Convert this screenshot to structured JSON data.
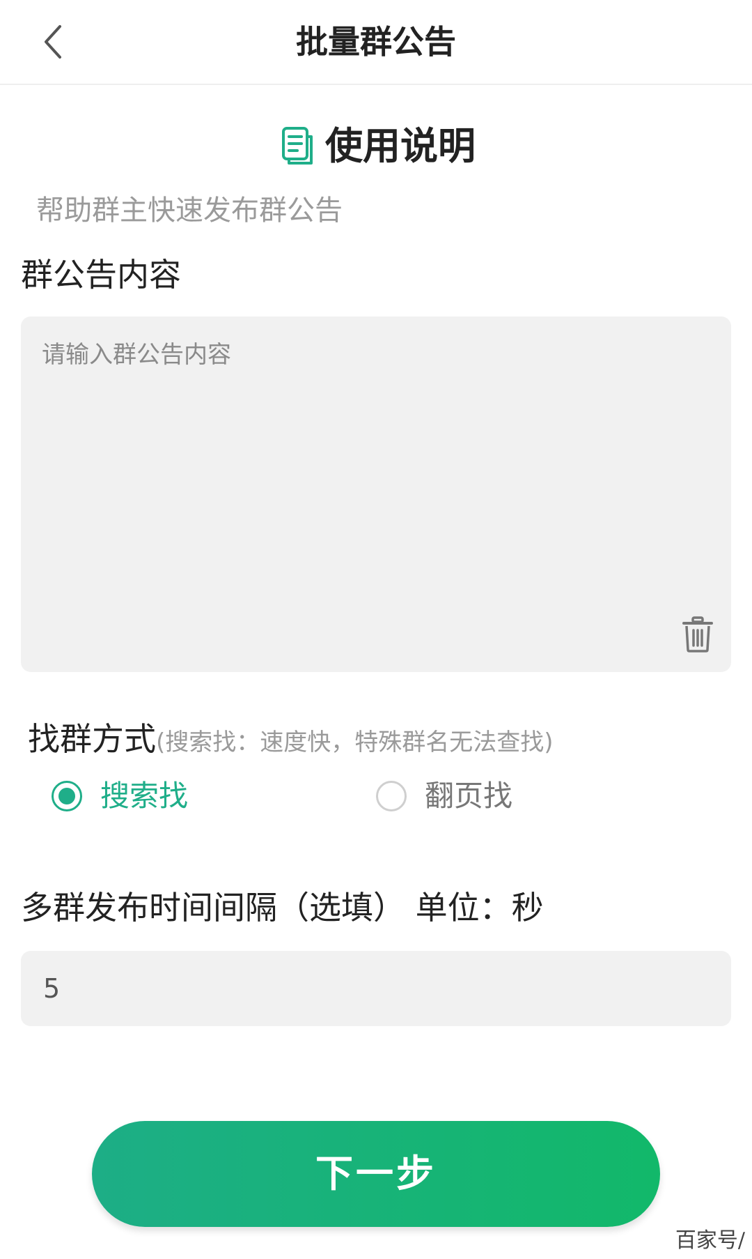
{
  "header": {
    "title": "批量群公告",
    "back_icon": "chevron-left-icon"
  },
  "usage": {
    "icon": "document-icon",
    "title": "使用说明",
    "description": "帮助群主快速发布群公告"
  },
  "announcement": {
    "label": "群公告内容",
    "placeholder": "请输入群公告内容",
    "value": "",
    "clear_icon": "trash-icon"
  },
  "find_method": {
    "label": "找群方式",
    "hint": "(搜索找：速度快，特殊群名无法查找)",
    "options": [
      {
        "label": "搜索找",
        "checked": true
      },
      {
        "label": "翻页找",
        "checked": false
      }
    ]
  },
  "interval": {
    "label": "多群发布时间间隔（选填） 单位：秒",
    "value": "5"
  },
  "next_button": {
    "label": "下一步"
  },
  "watermark": "百家号/",
  "colors": {
    "accent": "#1fae89",
    "button_start": "#1dae86",
    "button_end": "#12b86a",
    "input_bg": "#f1f1f1"
  }
}
